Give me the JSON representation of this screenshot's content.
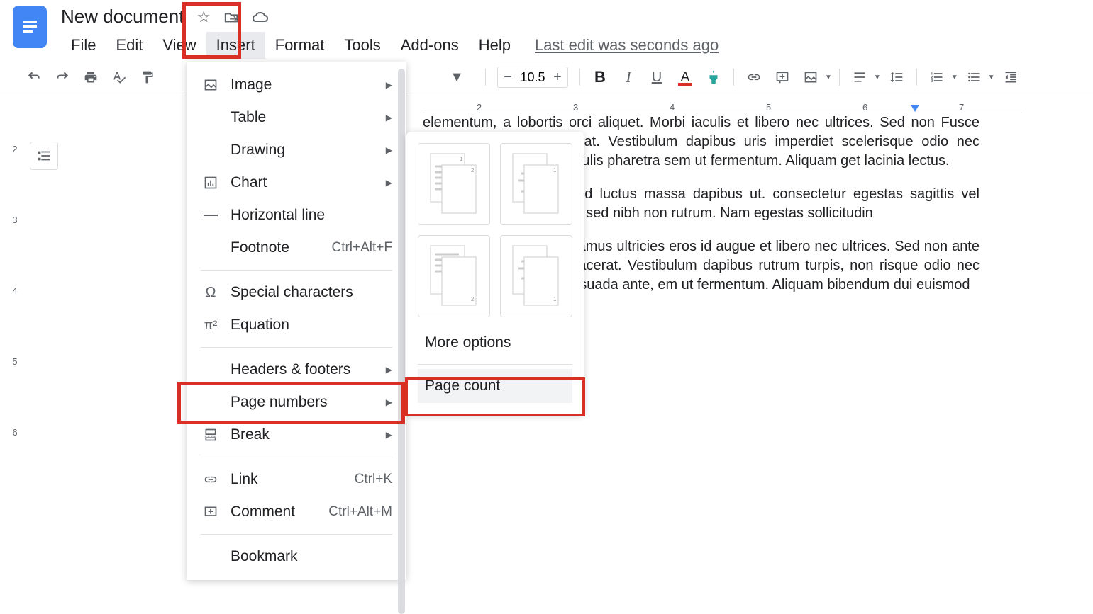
{
  "header": {
    "title": "New document",
    "last_edit": "Last edit was seconds ago"
  },
  "menu": {
    "file": "File",
    "edit": "Edit",
    "view": "View",
    "insert": "Insert",
    "format": "Format",
    "tools": "Tools",
    "addons": "Add-ons",
    "help": "Help"
  },
  "toolbar": {
    "font_size": "10.5"
  },
  "insert_menu": {
    "image": "Image",
    "table": "Table",
    "drawing": "Drawing",
    "chart": "Chart",
    "h_line": "Horizontal line",
    "footnote": "Footnote",
    "footnote_sc": "Ctrl+Alt+F",
    "special": "Special characters",
    "equation": "Equation",
    "headers": "Headers & footers",
    "page_numbers": "Page numbers",
    "break": "Break",
    "link": "Link",
    "link_sc": "Ctrl+K",
    "comment": "Comment",
    "comment_sc": "Ctrl+Alt+M",
    "bookmark": "Bookmark"
  },
  "submenu": {
    "more_options": "More options",
    "page_count": "Page count"
  },
  "ruler_h": {
    "t2": "2",
    "t3": "3",
    "t4": "4",
    "t5": "5",
    "t6": "6",
    "t7": "7"
  },
  "ruler_v": {
    "t2": "2",
    "t3": "3",
    "t4": "4",
    "t5": "5",
    "t6": "6"
  },
  "document": {
    "p1": "elementum, a lobortis orci aliquet. Morbi iaculis et libero nec ultrices. Sed non Fusce efficitur venenatis placerat. Vestibulum dapibus uris imperdiet scelerisque odio nec aliquet. Praesent mus iaculis pharetra sem ut fermentum. Aliquam get lacinia lectus.",
    "p2": "suada vehicula dolor, sed luctus massa dapibus ut. consectetur egestas sagittis vel magna. Maecenas eugiat sed nibh non rutrum. Nam egestas sollicitudin",
    "p3": "osuere cubilia curae; Vivamus ultricies eros id augue et libero nec ultrices. Sed non ante imperdiet, viverra atis placerat. Vestibulum dapibus rutrum turpis, non risque odio nec aliquet. Praesent et malesuada ante, em ut fermentum. Aliquam bibendum dui euismod"
  }
}
